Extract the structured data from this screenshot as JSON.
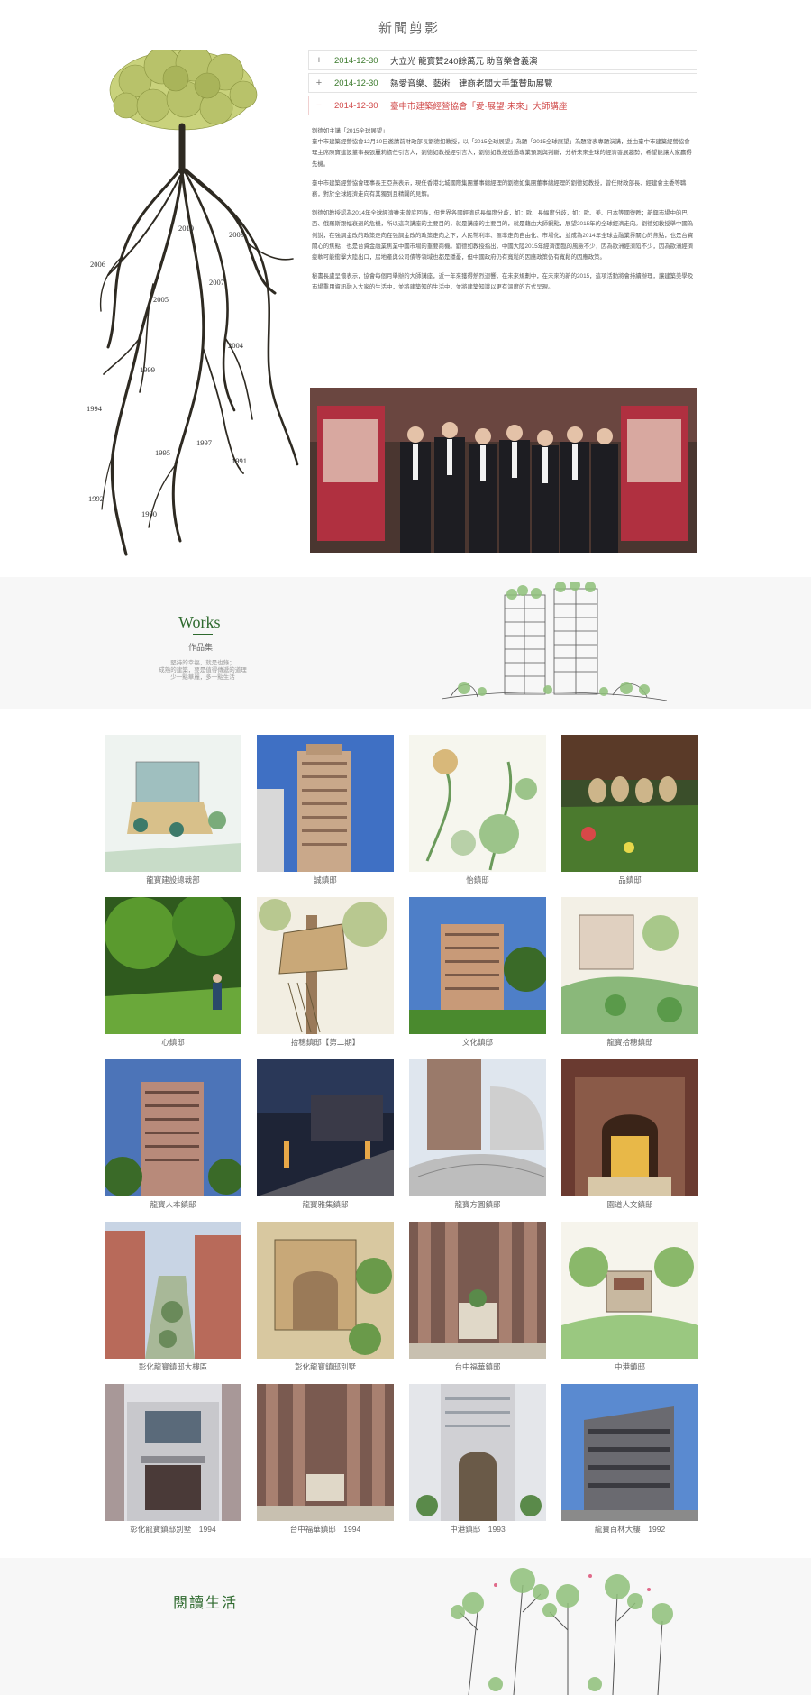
{
  "news": {
    "title": "新聞剪影",
    "items": [
      {
        "sign": "+",
        "date": "2014-12-30",
        "text": "大立光 龍寶贊240餘萬元 助音樂會義演",
        "active": false
      },
      {
        "sign": "+",
        "date": "2014-12-30",
        "text": "熱愛音樂、藝術　建商老闆大手筆贊助展覽",
        "active": false
      },
      {
        "sign": "−",
        "date": "2014-12-30",
        "text": "臺中市建築經營協會「愛·展望·未來」大師講座",
        "active": true
      }
    ],
    "article": [
      "劉德如主講「2015全球展望」",
      "臺中市建築經營協會12月10日邀請前財政部長劉德如教授，以「2015全球展望」為題「2015全球展望」為題發表專題演講，並由臺中市建築經營協會理主席陳寶建設董事長張麗莉擔任引言人，劉德如教授經引言人，劉德如教授透過專業預測與判斷，分析未來全球的經濟發展趨勢，希望能讓大家贏得先機。",
      "臺中市建築經營協會理事長王亞燕表示，現任香港北城國際集團董事總經理的劉德如集團董事總經理的劉德如教授，曾任財政部長、經建會主委等職務，對於全球經濟走向有其獨到且精闢的見解。",
      "劉德如教授認為2014年全球經濟雖未澈底回春，但世界各國經濟成長幅度分歧，如：歐、長幅度分歧，如：歐、美、日本等國復甦；新興市場中的巴西、俄羅斯跟幅衰退的危機，所以這次講座的主要目的，就是講座的主要目的，就是藉由大師觀點，展望2015年的全球經濟走向。劉德如教授舉中國為例說，在強調金改的政策走向在強調金改的政策走向之下，人民幣利率、匯率走向自由化、市場化，並成為2014年全球金融業界關心的焦點，也是台資關心的焦點，也是台資金融業焦業中國市場的重要商機。劉德如教授指出，中國大陸2015年經濟面臨的風險不少，因為歐洲經濟陷不少，因為歐洲經濟疲軟可能衝擊大陸出口，房地產與公司債等領域也都是隱憂，但中國政府仍有寬鬆的因應政策仍有寬鬆的因應政策。",
      "秘書長盧呈懷表示，協會每個月舉辦的大師講座，近一年來獲得熱烈迴響，在未來規劃中，在未來的新的2015，這項活動將會持續辦理，讓建築美學及市場重用資訊融入大家的生活中，並將建築知的生活中，並將建築知識以更有溫度的方式呈現。"
    ],
    "years": [
      "2009",
      "2010",
      "2006",
      "2007",
      "2005",
      "2004",
      "1999",
      "1994",
      "1997",
      "1995",
      "1991",
      "1992",
      "1990"
    ]
  },
  "works": {
    "title": "Works",
    "subtitle": "作品集",
    "desc": [
      "堅持的幸福，就是也錄；",
      "成熟的建築，要是值得傳遞的道理",
      "少一點華麗，多一點生活"
    ],
    "items": [
      {
        "caption": "龍寶建設總裁部"
      },
      {
        "caption": "誠鎮邸"
      },
      {
        "caption": "怡鎮邸"
      },
      {
        "caption": "品鎮邸"
      },
      {
        "caption": "心鎮邸"
      },
      {
        "caption": "拾穗鎮邸【第二期】"
      },
      {
        "caption": "文化鎮邸"
      },
      {
        "caption": "龍寶拾穗鎮邸"
      },
      {
        "caption": "龍寶人本鎮邸"
      },
      {
        "caption": "龍寶雅集鎮邸"
      },
      {
        "caption": "龍寶方圓鎮邸"
      },
      {
        "caption": "園道人文鎮邸"
      },
      {
        "caption": "彰化龍寶鎮邸大樓區"
      },
      {
        "caption": "彰化龍寶鎮邸別墅"
      },
      {
        "caption": "台中福華鎮邸"
      },
      {
        "caption": "中港鎮邸"
      },
      {
        "caption": "彰化龍寶鎮邸別墅　1994"
      },
      {
        "caption": "台中福華鎮邸　1994"
      },
      {
        "caption": "中港鎮邸　1993"
      },
      {
        "caption": "龍寶百林大樓　1992"
      }
    ]
  },
  "reading": {
    "title": "閱讀生活"
  },
  "colors": {
    "accent_green": "#2e6a2e",
    "active_red": "#d04848",
    "band_gray": "#f7f7f7"
  }
}
